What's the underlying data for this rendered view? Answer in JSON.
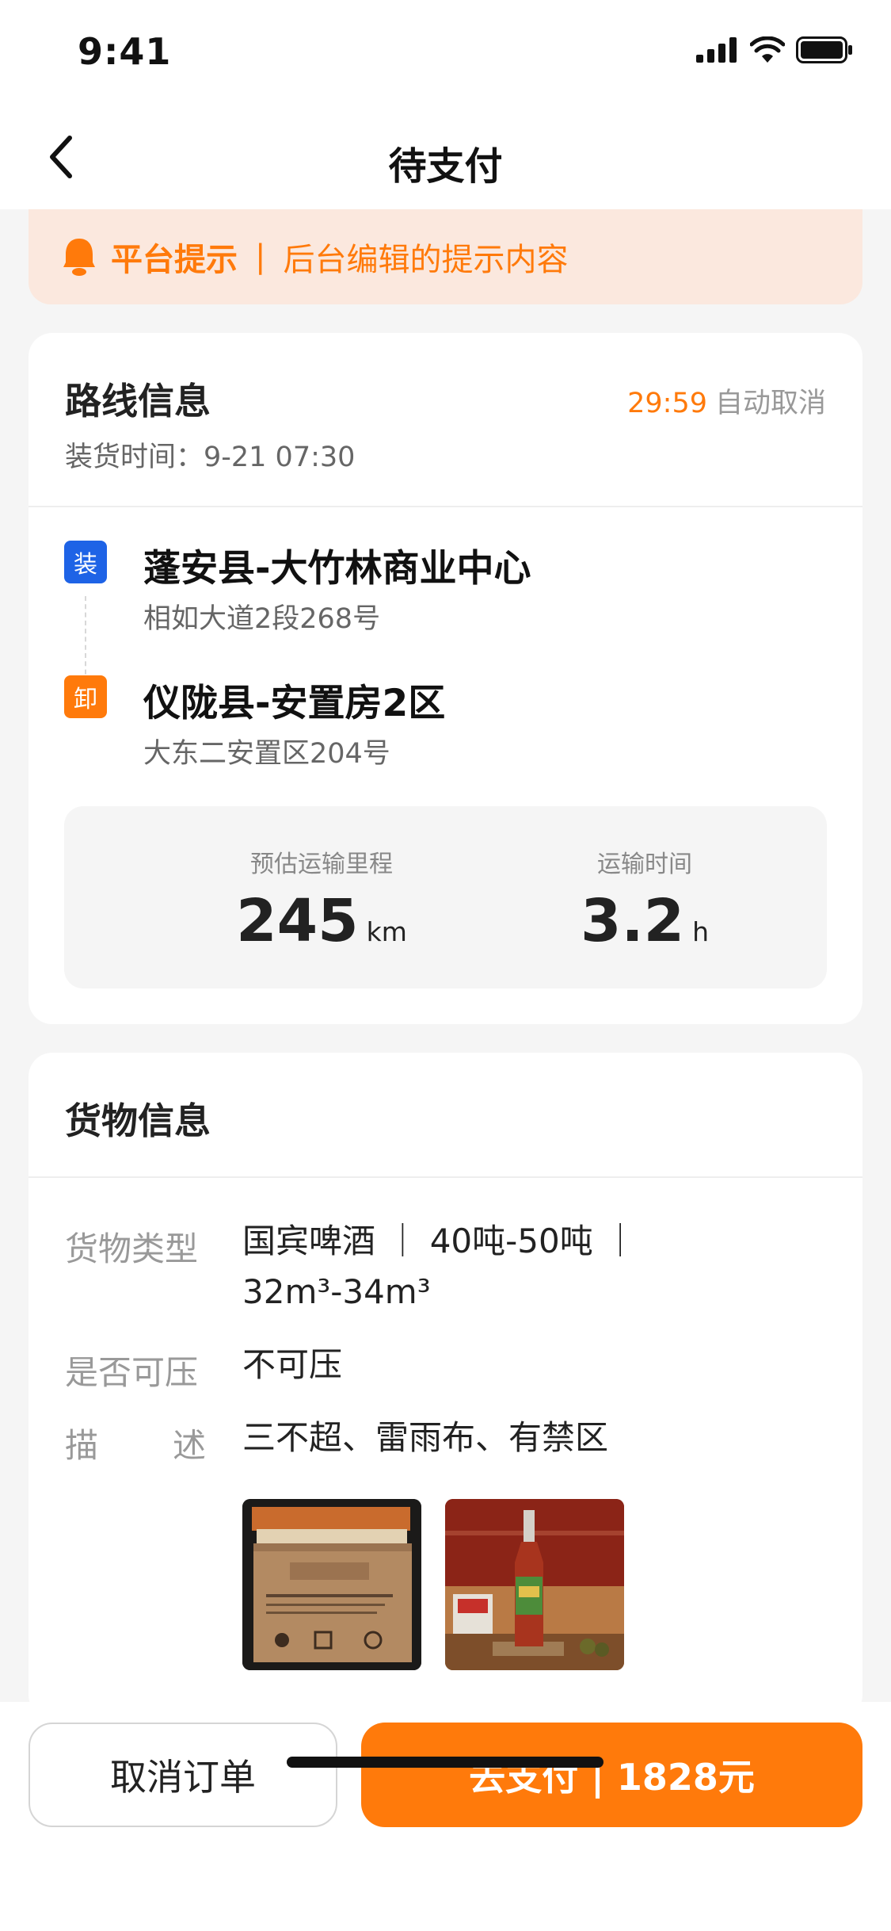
{
  "status_bar": {
    "time": "9:41"
  },
  "nav": {
    "title": "待支付"
  },
  "notice": {
    "title": "平台提示",
    "separator": "|",
    "content": "后台编辑的提示内容"
  },
  "route": {
    "title": "路线信息",
    "countdown_time": "29:59",
    "countdown_text": "自动取消",
    "load_time": "装货时间：9-21 07:30",
    "origin": {
      "tag": "装",
      "name": "蓬安县-大竹林商业中心",
      "address": "相如大道2段268号"
    },
    "destination": {
      "tag": "卸",
      "name": "仪陇县-安置房2区",
      "address": "大东二安置区204号"
    },
    "distance": {
      "label": "预估运输里程",
      "value": "245",
      "unit": "km"
    },
    "duration": {
      "label": "运输时间",
      "value": "3.2",
      "unit": "h"
    }
  },
  "cargo": {
    "title": "货物信息",
    "type_label": "货物类型",
    "type_line1": "国宾啤酒 ｜ 40吨-50吨 ｜",
    "type_line2": "32m³-34m³",
    "compress_label": "是否可压",
    "compress_value": "不可压",
    "desc_label_1": "描",
    "desc_label_2": "述",
    "desc_value": "三不超、雷雨布、有禁区"
  },
  "footer": {
    "cancel_label": "取消订单",
    "pay_label": "去支付 | 1828元"
  },
  "colors": {
    "accent": "#ff7a0b",
    "load_tag": "#1e63e6",
    "notice_bg": "#fbe8de"
  }
}
